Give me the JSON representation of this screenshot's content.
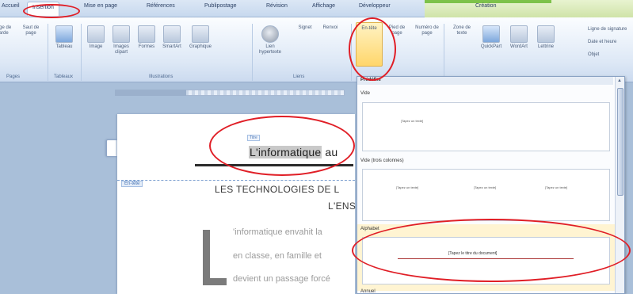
{
  "tabs": [
    "Accueil",
    "Insertion",
    "Mise en page",
    "Références",
    "Publipostage",
    "Révision",
    "Affichage",
    "Développeur",
    "Création"
  ],
  "ribbon": {
    "buttons": [
      "Page de garde",
      "Saut de page",
      "Tableau",
      "Image",
      "Images clipart",
      "Formes",
      "SmartArt",
      "Graphique",
      "Lien hypertexte",
      "Signet",
      "Renvoi",
      "En-tête",
      "Pied de page",
      "Numéro de page",
      "Zone de texte",
      "QuickPart",
      "WordArt",
      "Lettrine"
    ],
    "small_items": [
      "Ligne de signature",
      "Date et heure",
      "Objet"
    ],
    "groups": [
      "Pages",
      "Tableaux",
      "Illustrations",
      "Liens"
    ]
  },
  "document": {
    "title_tag": "Titre",
    "title_bold": "L'informatique",
    "title_rest": " au",
    "header_tag": "En-tête",
    "header_line1": "LES TECHNOLOGIES DE L",
    "header_line2": "L'ENS",
    "body": [
      "'informatique envahit la",
      "en classe, en famille et",
      "devient un passage forcé"
    ]
  },
  "gallery": {
    "section_header": "Prédéfini",
    "items": [
      {
        "label": "Vide",
        "placeholders": [
          "[Tapez un texte]"
        ]
      },
      {
        "label": "Vide (trois colonnes)",
        "placeholders": [
          "[Tapez un texte]",
          "[Tapez un texte]",
          "[Tapez un texte]"
        ]
      },
      {
        "label": "Alphabet",
        "placeholders": [
          "[Tapez le titre du document]"
        ]
      },
      {
        "label": "Annuel",
        "placeholders": []
      }
    ]
  },
  "colors": {
    "annotation": "#e01e26",
    "active_tab": "#fdfdfd",
    "highlight": "#ffd66b"
  }
}
